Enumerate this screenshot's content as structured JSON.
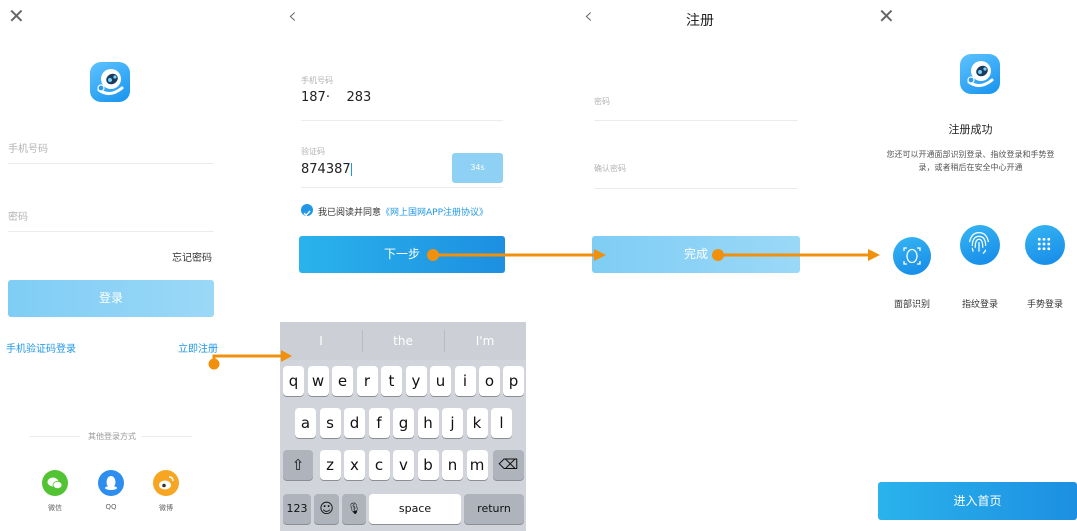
{
  "login": {
    "close_icon": "close-icon",
    "phone_placeholder": "手机号码",
    "password_placeholder": "密码",
    "forgot_password": "忘记密码",
    "login_button": "登录",
    "sms_login": "手机验证码登录",
    "register_now": "立即注册",
    "other_methods": "其他登录方式",
    "socials": [
      {
        "label": "微信",
        "icon": "wechat-icon",
        "color": "#52c433"
      },
      {
        "label": "QQ",
        "icon": "qq-icon",
        "color": "#2e8ef0"
      },
      {
        "label": "微博",
        "icon": "weibo-icon",
        "color": "#f6a623"
      }
    ]
  },
  "verify": {
    "back_icon": "back-icon",
    "phone_label": "手机号码",
    "phone_value": "187·    283",
    "code_label": "验证码",
    "code_value": "874387",
    "countdown": "34s",
    "agree_prefix": "我已阅读并同意",
    "agreement_link": "《网上国网APP注册协议》",
    "next_button": "下一步",
    "keyboard": {
      "suggestions": [
        "I",
        "the",
        "I'm"
      ],
      "row1": [
        "q",
        "w",
        "e",
        "r",
        "t",
        "y",
        "u",
        "i",
        "o",
        "p"
      ],
      "row2": [
        "a",
        "s",
        "d",
        "f",
        "g",
        "h",
        "j",
        "k",
        "l"
      ],
      "row3": [
        "z",
        "x",
        "c",
        "v",
        "b",
        "n",
        "m"
      ],
      "shift": "⇧",
      "delete": "⌫",
      "numbers": "123",
      "emoji": "☺",
      "mic": "🎙",
      "space": "space",
      "return": "return"
    }
  },
  "password": {
    "back_icon": "back-icon",
    "title": "注册",
    "password_placeholder": "密码",
    "confirm_placeholder": "确认密码",
    "done_button": "完成"
  },
  "success": {
    "close_icon": "close-icon",
    "title": "注册成功",
    "description_line1": "您还可以开通面部识别登录、指纹登录和手势登",
    "description_line2": "录，或者稍后在安全中心开通",
    "options": [
      {
        "label": "面部识别",
        "icon": "face-id-icon"
      },
      {
        "label": "指纹登录",
        "icon": "fingerprint-icon"
      },
      {
        "label": "手势登录",
        "icon": "gesture-grid-icon"
      }
    ],
    "home_button": "进入首页"
  },
  "colors": {
    "accent": "#1f97e6",
    "arrow": "#f0900d",
    "button_light": "#8fd3f6",
    "button_strong": "#1d9ae5"
  }
}
